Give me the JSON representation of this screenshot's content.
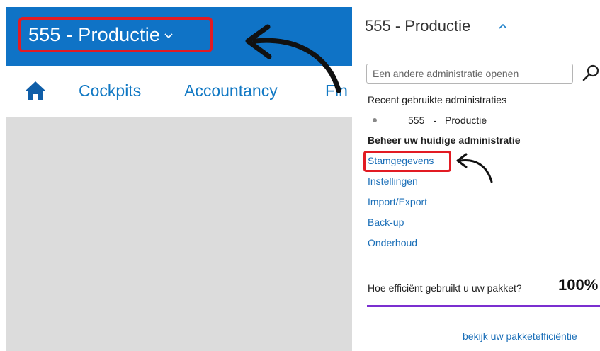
{
  "app": {
    "admin_selector_label": "555 - Productie",
    "nav": {
      "items": [
        {
          "label": "Cockpits"
        },
        {
          "label": "Accountancy"
        },
        {
          "label": "Fin"
        }
      ]
    }
  },
  "dropdown": {
    "title": "555 - Productie",
    "open_placeholder": "Een andere administratie openen",
    "recent_heading": "Recent gebruikte administraties",
    "recent_items": [
      {
        "code": "555",
        "separator": "-",
        "name": "Productie"
      }
    ],
    "manage_heading": "Beheer uw huidige administratie",
    "links": [
      {
        "label": "Stamgegevens"
      },
      {
        "label": "Instellingen"
      },
      {
        "label": "Import/Export"
      },
      {
        "label": "Back-up"
      },
      {
        "label": "Onderhoud"
      }
    ],
    "efficiency_question": "Hoe efficiënt gebruikt u uw pakket?",
    "efficiency_value": "100%",
    "efficiency_fraction": 1.0,
    "package_link": "bekijk uw pakketefficiëntie"
  },
  "colors": {
    "topbar": "#0f73c6",
    "highlight": "#e21b23",
    "link": "#1b6fb8",
    "progress": "#7b2fd0",
    "content_bg": "#dcdcdc"
  },
  "icons": {
    "home": "home-icon",
    "chevron_down": "chevron-down-icon",
    "chevron_up": "chevron-up-icon",
    "search": "search-icon"
  }
}
